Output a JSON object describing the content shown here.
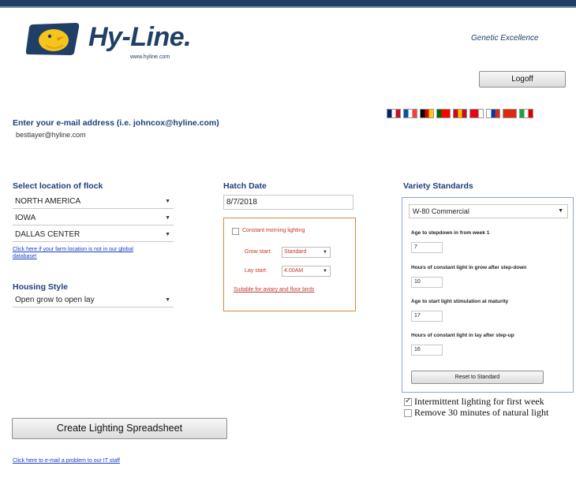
{
  "header": {
    "brand": "Hy-Line.",
    "brand_url": "www.hyline.com",
    "tagline": "Genetic Excellence",
    "logoff_label": "Logoff",
    "logo_icon": "chick-logo-icon"
  },
  "languages": [
    {
      "name": "english-flag-icon",
      "colors": [
        "#012169",
        "#ffffff",
        "#c8102e"
      ]
    },
    {
      "name": "french-flag-icon",
      "colors": [
        "#0055a4",
        "#ffffff",
        "#ef4135"
      ]
    },
    {
      "name": "german-flag-icon",
      "colors": [
        "#000000",
        "#dd0000",
        "#ffce00"
      ]
    },
    {
      "name": "portuguese-flag-icon",
      "colors": [
        "#006600",
        "#ff0000",
        "#ff0000"
      ]
    },
    {
      "name": "spanish-flag-icon",
      "colors": [
        "#c60b1e",
        "#ffc400",
        "#c60b1e"
      ]
    },
    {
      "name": "turkish-flag-icon",
      "colors": [
        "#e30a17",
        "#e30a17",
        "#ffffff"
      ]
    },
    {
      "name": "russian-flag-icon",
      "colors": [
        "#ffffff",
        "#0039a6",
        "#d52b1e"
      ]
    },
    {
      "name": "chinese-flag-icon",
      "colors": [
        "#de2910",
        "#de2910",
        "#de2910"
      ]
    },
    {
      "name": "iranian-flag-icon",
      "colors": [
        "#239f40",
        "#ffffff",
        "#da0000"
      ]
    }
  ],
  "email": {
    "label": "Enter your e-mail address (i.e. johncox@hyline.com)",
    "value": "bestlayer@hyline.com"
  },
  "location": {
    "label": "Select location of flock",
    "region": "NORTH AMERICA",
    "state": "IOWA",
    "city": "DALLAS CENTER",
    "farm_link": "Click here if your farm location is not in our global database!"
  },
  "housing": {
    "label": "Housing Style",
    "value": "Open grow to open lay"
  },
  "hatch": {
    "label": "Hatch Date",
    "value": "8/7/2018"
  },
  "lighting": {
    "constant_label": "Constant morning lighting",
    "grow_label": "Grow start:",
    "grow_value": "Standard",
    "lay_label": "Lay start:",
    "lay_value": "4:00AM",
    "suitable_link": "Suitable for aviary and floor birds"
  },
  "variety": {
    "label": "Variety Standards",
    "value": "W-80 Commercial",
    "q1": "Age to stepdown in from week 1",
    "v1": "7",
    "q2": "Hours of constant light in grow after step-down",
    "v2": "10",
    "q3": "Age to start light stimulation at maturity",
    "v3": "17",
    "q4": "Hours of constant light in lay after step-up",
    "v4": "16",
    "reset_label": "Reset to Standard"
  },
  "options": {
    "intermittent_label": "Intermittent lighting for first week",
    "intermittent_checked": true,
    "remove_label": "Remove 30 minutes of natural light",
    "remove_checked": false
  },
  "actions": {
    "create_label": "Create Lighting Spreadsheet",
    "problem_link": "Click here to e-mail a problem to our IT staff"
  }
}
